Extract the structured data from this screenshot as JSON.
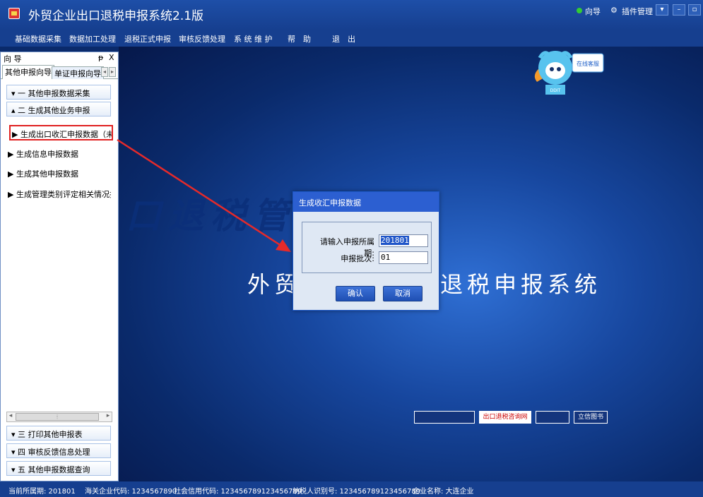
{
  "app": {
    "title": "外贸企业出口退税申报系统2.1版"
  },
  "menu": [
    "基础数据采集",
    "数据加工处理",
    "退税正式申报",
    "审核反馈处理",
    "系 统 维 护",
    "帮　助",
    "退　出"
  ],
  "top_right": {
    "guide": "向导",
    "plugin": "插件管理"
  },
  "panel": {
    "title": "向 导",
    "pin": "ᵽ",
    "close": "X",
    "tabs": [
      "其他申报向导",
      "单证申报向导"
    ],
    "groups_top": [
      "一 其他申报数据采集",
      "二 生成其他业务申报"
    ],
    "leaves": [
      "生成出口收汇申报数据（未认定",
      "生成信息申报数据",
      "生成其他申报数据",
      "生成管理类别评定相关情况报告"
    ],
    "groups_bottom": [
      "三 打印其他申报表",
      "四 审核反馈信息处理",
      "五 其他申报数据查询"
    ]
  },
  "background": {
    "big_text": "口退税管",
    "sub_left": "外贸",
    "sub_right": "退税申报系统",
    "mascot_badge": "在线客服",
    "mascot_label": "DDIT"
  },
  "logos": [
    "",
    "出口退税咨询网",
    "",
    "立信图书"
  ],
  "dialog": {
    "title": "生成收汇申报数据",
    "period_label": "请输入申报所属期:",
    "period_value": "201801",
    "batch_label": "申报批次:",
    "batch_value": "01",
    "ok": "确认",
    "cancel": "取消"
  },
  "status": {
    "period": "当前所属期: 201801",
    "customs": "海关企业代码: 1234567890",
    "credit": "社会信用代码: 123456789123456789",
    "taxpayer": "纳税人识别号: 123456789123456789",
    "company": "企业名称: 大连企业"
  }
}
